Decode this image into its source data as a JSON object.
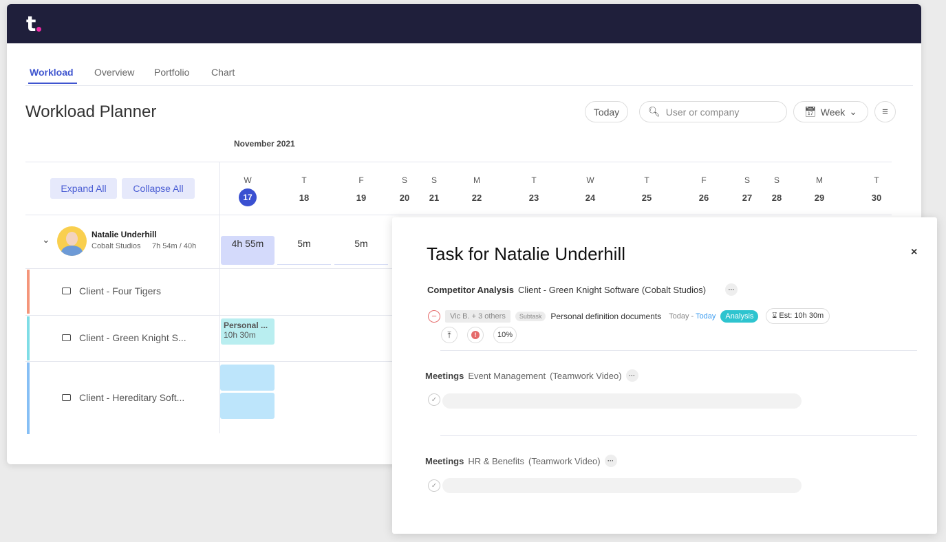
{
  "app": {
    "logo": "t"
  },
  "tabs": [
    {
      "label": "Workload"
    },
    {
      "label": "Overview"
    },
    {
      "label": "Portfolio"
    },
    {
      "label": "Chart"
    }
  ],
  "header": {
    "title": "Workload Planner",
    "today": "Today",
    "search_placeholder": "User or company",
    "view": "Week"
  },
  "calendar": {
    "month": "November 2021",
    "expand_all": "Expand All",
    "collapse_all": "Collapse All",
    "days": [
      {
        "d": "W",
        "n": "17",
        "today": true
      },
      {
        "d": "T",
        "n": "18"
      },
      {
        "d": "F",
        "n": "19"
      },
      {
        "d": "S",
        "n": "20"
      },
      {
        "d": "S",
        "n": "21"
      },
      {
        "d": "M",
        "n": "22"
      },
      {
        "d": "T",
        "n": "23"
      },
      {
        "d": "W",
        "n": "24"
      },
      {
        "d": "T",
        "n": "25"
      },
      {
        "d": "F",
        "n": "26"
      },
      {
        "d": "S",
        "n": "27"
      },
      {
        "d": "S",
        "n": "28"
      },
      {
        "d": "M",
        "n": "29"
      },
      {
        "d": "T",
        "n": "30"
      }
    ]
  },
  "user": {
    "name": "Natalie Underhill",
    "company": "Cobalt Studios",
    "hours": "7h 54m / 40h",
    "cells": [
      "4h 55m",
      "5m",
      "5m"
    ]
  },
  "clients": [
    {
      "name": "Client - Four Tigers",
      "color": "#f4957a"
    },
    {
      "name": "Client - Green Knight S...",
      "color": "#7fdde6"
    },
    {
      "name": "Client - Hereditary Soft...",
      "color": "#86bff5"
    }
  ],
  "task_block": {
    "title": "Personal ...",
    "time": "10h 30m"
  },
  "panel": {
    "title": "Task for Natalie Underhill",
    "close": "×",
    "task": {
      "list": "Competitor Analysis",
      "project": "Client - Green Knight Software (Cobalt Studios)",
      "assignees": "Vic B. + 3 others",
      "type": "Subtask",
      "name": "Personal definition documents",
      "start": "Today",
      "end": "Today",
      "tag": "Analysis",
      "estimate": "Est: 10h 30m",
      "progress": "10%"
    },
    "groups": [
      {
        "list": "Meetings",
        "project": "Event Management",
        "company": "(Teamwork Video)"
      },
      {
        "list": "Meetings",
        "project": "HR & Benefits",
        "company": "(Teamwork Video)"
      }
    ]
  }
}
